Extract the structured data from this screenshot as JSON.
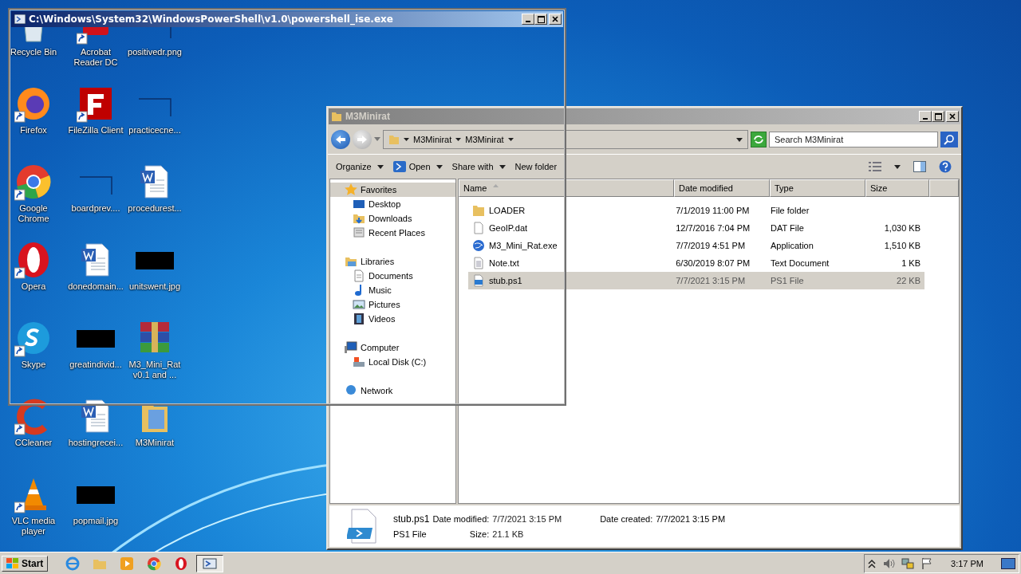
{
  "desktop": {
    "icons": [
      {
        "label": "Recycle Bin",
        "kind": "recycle",
        "shortcut": false
      },
      {
        "label": "Firefox",
        "kind": "firefox",
        "shortcut": true
      },
      {
        "label": "Google Chrome",
        "kind": "chrome",
        "shortcut": true
      },
      {
        "label": "Opera",
        "kind": "opera",
        "shortcut": true
      },
      {
        "label": "Skype",
        "kind": "skype",
        "shortcut": true
      },
      {
        "label": "CCleaner",
        "kind": "ccleaner",
        "shortcut": true
      },
      {
        "label": "VLC media player",
        "kind": "vlc",
        "shortcut": true
      },
      {
        "label": "Acrobat Reader DC",
        "kind": "acrobat",
        "shortcut": true
      },
      {
        "label": "FileZilla Client",
        "kind": "filezilla",
        "shortcut": true
      },
      {
        "label": "boardprev....",
        "kind": "thumb",
        "shortcut": false
      },
      {
        "label": "donedomain...",
        "kind": "word",
        "shortcut": false
      },
      {
        "label": "greatindivid...",
        "kind": "black",
        "shortcut": false
      },
      {
        "label": "hostingrecei...",
        "kind": "word",
        "shortcut": false
      },
      {
        "label": "popmail.jpg",
        "kind": "black",
        "shortcut": false
      },
      {
        "label": "positivedr.png",
        "kind": "thumb",
        "shortcut": false
      },
      {
        "label": "practicecne...",
        "kind": "thumb",
        "shortcut": false
      },
      {
        "label": "procedurest...",
        "kind": "word",
        "shortcut": false
      },
      {
        "label": "unitswent.jpg",
        "kind": "black",
        "shortcut": false
      },
      {
        "label": "M3_Mini_Rat v0.1 and ...",
        "kind": "archive",
        "shortcut": false
      },
      {
        "label": "M3Minirat",
        "kind": "folder",
        "shortcut": false
      }
    ]
  },
  "ise_window": {
    "title": "C:\\Windows\\System32\\WindowsPowerShell\\v1.0\\powershell_ise.exe"
  },
  "explorer": {
    "title": "M3Minirat",
    "breadcrumb": [
      "M3Minirat",
      "M3Minirat"
    ],
    "search": {
      "placeholder": "Search M3Minirat"
    },
    "toolbar": [
      {
        "label": "Organize",
        "kind": "menu"
      },
      {
        "label": "Open",
        "kind": "open"
      },
      {
        "label": "Share with",
        "kind": "menu"
      },
      {
        "label": "New folder",
        "kind": "plain"
      }
    ],
    "nav": [
      {
        "label": "Favorites",
        "kind": "star",
        "selected": true,
        "children": [
          {
            "label": "Desktop",
            "kind": "desktop",
            "selected": false
          },
          {
            "label": "Downloads",
            "kind": "downloads",
            "selected": false
          },
          {
            "label": "Recent Places",
            "kind": "recent",
            "selected": false
          }
        ]
      },
      {
        "label": "Libraries",
        "kind": "libraries",
        "selected": false,
        "children": [
          {
            "label": "Documents",
            "kind": "documents",
            "selected": false
          },
          {
            "label": "Music",
            "kind": "music",
            "selected": false
          },
          {
            "label": "Pictures",
            "kind": "pictures",
            "selected": false
          },
          {
            "label": "Videos",
            "kind": "videos",
            "selected": false
          }
        ]
      },
      {
        "label": "Computer",
        "kind": "computer",
        "selected": false,
        "children": [
          {
            "label": "Local Disk (C:)",
            "kind": "disk",
            "selected": false
          }
        ]
      },
      {
        "label": "Network",
        "kind": "network",
        "selected": false
      }
    ],
    "columns": [
      "Name",
      "Date modified",
      "Type",
      "Size"
    ],
    "rows": [
      {
        "name": "LOADER",
        "date": "7/1/2019 11:00 PM",
        "type": "File folder",
        "kind": "folder",
        "selected": false
      },
      {
        "name": "GeoIP.dat",
        "date": "12/7/2016 7:04 PM",
        "type": "DAT File",
        "size": "1,030 KB",
        "kind": "blank",
        "selected": false
      },
      {
        "name": "M3_Mini_Rat.exe",
        "date": "7/7/2019 4:51 PM",
        "type": "Application",
        "size": "1,510 KB",
        "kind": "app",
        "selected": false
      },
      {
        "name": "Note.txt",
        "date": "6/30/2019 8:07 PM",
        "type": "Text Document",
        "size": "1 KB",
        "kind": "text",
        "selected": false
      },
      {
        "name": "stub.ps1",
        "date": "7/7/2021 3:15 PM",
        "type": "PS1 File",
        "size": "22 KB",
        "kind": "script",
        "selected": true
      }
    ],
    "details": {
      "name": "stub.ps1",
      "type": "PS1 File",
      "modified_label": "Date modified:",
      "modified": "7/7/2021 3:15 PM",
      "created_label": "Date created:",
      "created": "7/7/2021 3:15 PM",
      "size_label": "Size:",
      "size": "21.1 KB"
    }
  },
  "taskbar": {
    "start": "Start",
    "apps": [
      {
        "kind": "ie",
        "selected": false
      },
      {
        "kind": "explorer",
        "selected": false
      },
      {
        "kind": "media",
        "selected": false
      },
      {
        "kind": "chrome",
        "selected": false
      },
      {
        "kind": "opera",
        "selected": false
      },
      {
        "kind": "ise",
        "selected": true
      }
    ],
    "clock": "3:17 PM"
  }
}
